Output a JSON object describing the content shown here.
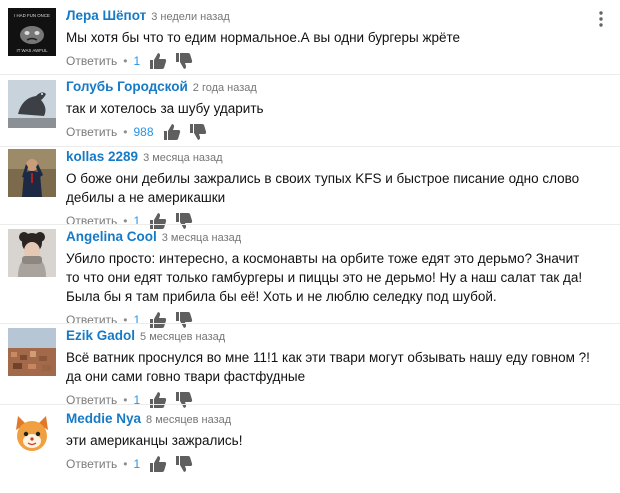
{
  "comments": [
    {
      "author": "Лера Шёпот",
      "time": "3 недели назад",
      "text": "Мы хотя бы что то едим нормальное.А вы одни бургеры жрёте",
      "reply_label": "Ответить",
      "separator": "•",
      "likes": "1",
      "avatar_icon": "grumpy-cat-meme-avatar",
      "avatar_caption_top": "I HAD FUN ONCE",
      "avatar_caption_bottom": "IT WAS AWFUL"
    },
    {
      "author": "Голубь Городской",
      "time": "2 года назад",
      "text": "так и хотелось за шубу ударить",
      "reply_label": "Ответить",
      "separator": "•",
      "likes": "988",
      "avatar_icon": "pigeon-statue-avatar"
    },
    {
      "author": "kollas 2289",
      "time": "3 месяца назад",
      "text": "О боже  они дебилы зажрались в своих тупых KFS и быстрое писание одно слово дебилы а не америкашки",
      "reply_label": "Ответить",
      "separator": "•",
      "likes": "1",
      "avatar_icon": "man-in-suit-avatar"
    },
    {
      "author": "Angelina Cool",
      "time": "3 месяца назад",
      "text": "Убило просто: интересно, а космонавты на орбите тоже едят это дерьмо? Значит то что они едят только гамбургеры и пиццы это не дерьмо! Ну а наш салат так да! Была бы я там прибила бы её! Хоть и не люблю селедку под шубой.",
      "reply_label": "Ответить",
      "separator": "•",
      "likes": "1",
      "avatar_icon": "girl-with-scarf-avatar"
    },
    {
      "author": "Ezik Gadol",
      "time": "5 месяцев назад",
      "text": "Всё ватник проснулся во мне 11!1 как эти твари могут обзывать нашу еду говном ?! да они сами говно твари фастфудные",
      "reply_label": "Ответить",
      "separator": "•",
      "likes": "1",
      "avatar_icon": "city-panorama-avatar"
    },
    {
      "author": "Meddie Nya",
      "time": "8 месяцев назад",
      "text": "эти американцы зажрались!",
      "reply_label": "Ответить",
      "separator": "•",
      "likes": "1",
      "avatar_icon": "cartoon-fox-avatar"
    }
  ],
  "icons": {
    "like": "thumbs-up-icon",
    "dislike": "thumbs-down-icon",
    "menu": "vertical-dots-menu-icon"
  },
  "colors": {
    "author": "#167ac6",
    "likes": "#2793e6",
    "meta": "#767676",
    "text": "#111111"
  }
}
